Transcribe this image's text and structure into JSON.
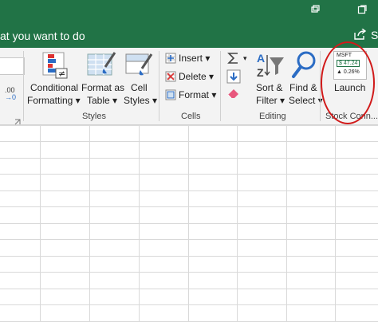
{
  "tell_me": {
    "text": "at you want to do"
  },
  "header": {
    "user_letter": "S"
  },
  "number_group": {
    "decimal_a": ".00",
    "decimal_b": "→0"
  },
  "styles": {
    "conditional_formatting": [
      "Conditional",
      "Formatting ▾"
    ],
    "format_as_table": [
      "Format as",
      "Table ▾"
    ],
    "cell_styles": [
      "Cell",
      "Styles ▾"
    ],
    "label": "Styles"
  },
  "cells": {
    "insert": "Insert ▾",
    "delete": "Delete ▾",
    "format": "Format ▾",
    "label": "Cells"
  },
  "editing": {
    "sum_arrow": "▾",
    "sort_filter": [
      "Sort &",
      "Filter ▾"
    ],
    "find_select": [
      "Find &",
      "Select ▾"
    ],
    "label": "Editing"
  },
  "stock": {
    "ticker": "MSFT",
    "price": "$ 47.24",
    "change": "▲ 0.26%",
    "launch": "Launch",
    "label": "Stock Conn..."
  },
  "colors": {
    "excel_green": "#217346",
    "ribbon_bg": "#f3f3f3",
    "highlight_circle": "#d11a1a"
  }
}
